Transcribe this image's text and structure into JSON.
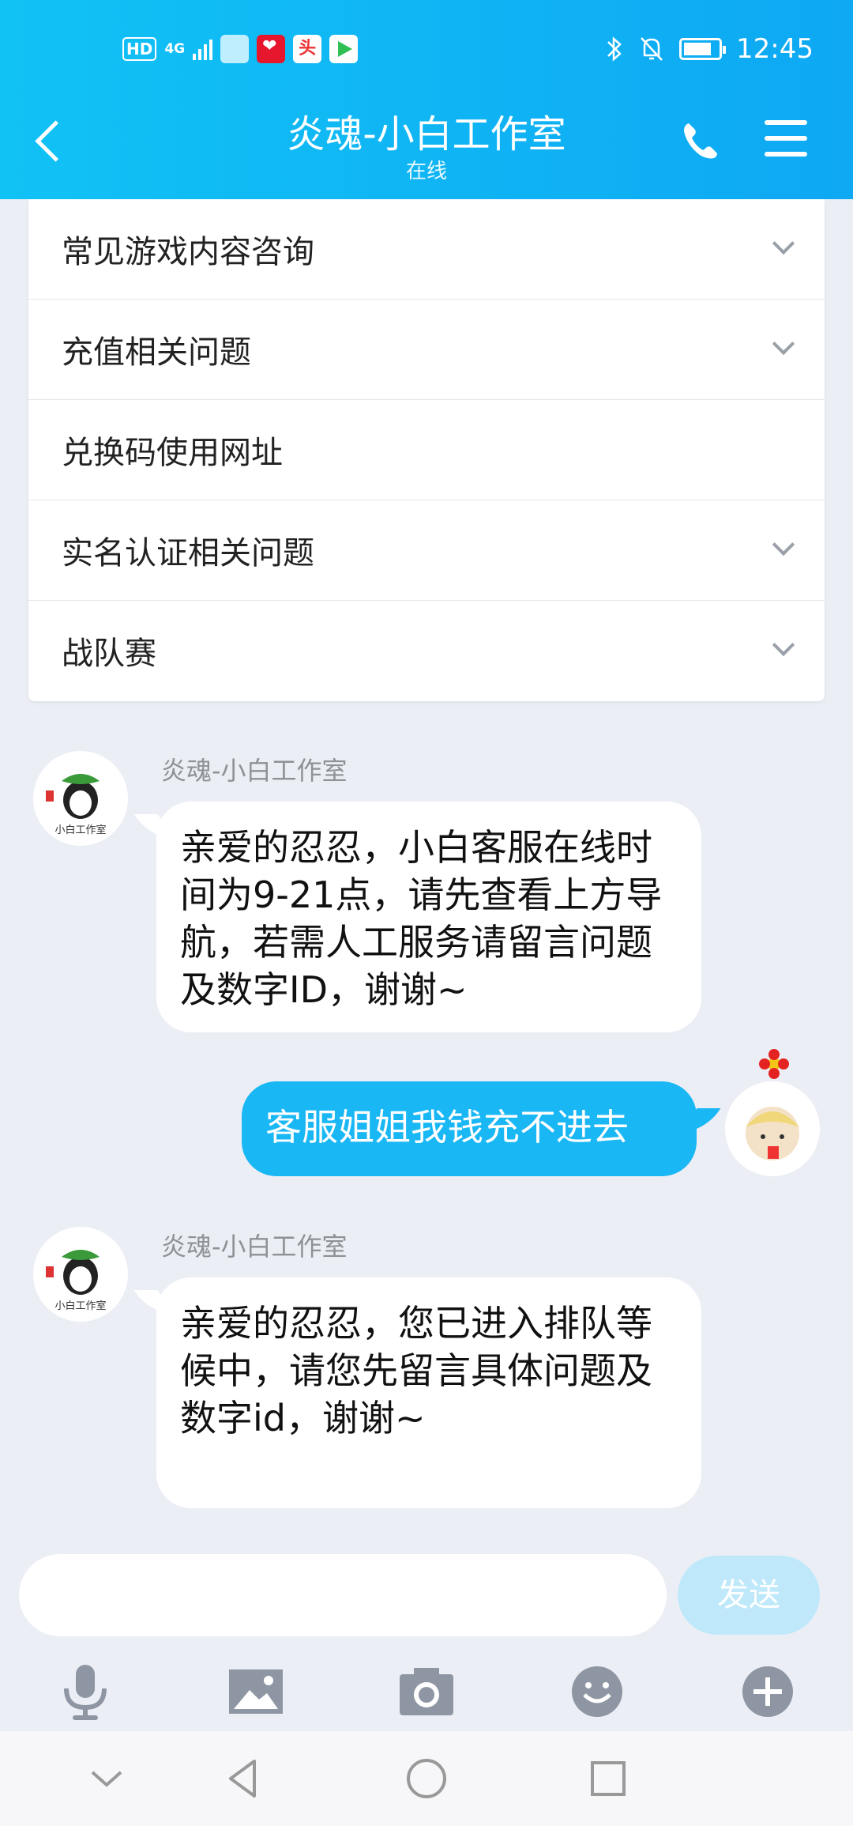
{
  "status_bar": {
    "hd": "HD",
    "network": "4G",
    "time": "12:45"
  },
  "header": {
    "title": "炎魂-小白工作室",
    "subtitle": "在线"
  },
  "faq": {
    "items": [
      {
        "label": "常见游戏内容咨询",
        "expandable": true
      },
      {
        "label": "充值相关问题",
        "expandable": true
      },
      {
        "label": "兑换码使用网址",
        "expandable": false
      },
      {
        "label": "实名认证相关问题",
        "expandable": true
      },
      {
        "label": "战队赛",
        "expandable": true
      }
    ]
  },
  "messages": [
    {
      "from": "agent",
      "sender": "炎魂-小白工作室",
      "avatar_text": "小白工作室",
      "text": "亲爱的忍忍，小白客服在线时间为9-21点，请先查看上方导航，若需人工服务请留言问题及数字ID，谢谢~"
    },
    {
      "from": "me",
      "text": "客服姐姐我钱充不进去"
    },
    {
      "from": "agent",
      "sender": "炎魂-小白工作室",
      "avatar_text": "小白工作室",
      "text": "亲爱的忍忍，您已进入排队等候中，请您先留言具体问题及数字id，谢谢~"
    }
  ],
  "composer": {
    "placeholder": "",
    "send_label": "发送"
  },
  "colors": {
    "header": "#0ea8f3",
    "out_bubble": "#1ab7f5",
    "send_disabled": "#bfe9fb",
    "background": "#eceef5"
  },
  "icons": [
    "back-icon",
    "phone-icon",
    "menu-icon",
    "chevron-down-icon",
    "microphone-icon",
    "image-icon",
    "camera-icon",
    "emoji-icon",
    "plus-icon"
  ]
}
